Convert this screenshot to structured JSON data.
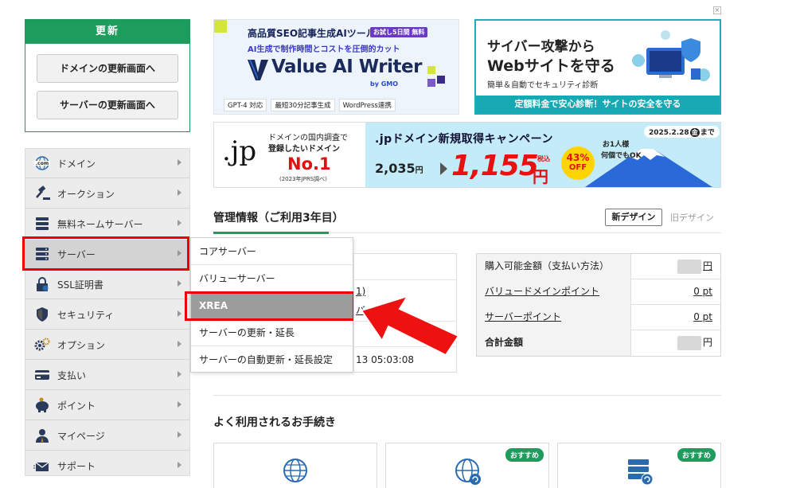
{
  "renew": {
    "title": "更新",
    "domain_btn": "ドメインの更新画面へ",
    "server_btn": "サーバーの更新画面へ"
  },
  "nav": {
    "items": [
      {
        "label": "ドメイン",
        "icon": "globe-com-icon"
      },
      {
        "label": "オークション",
        "icon": "gavel-icon"
      },
      {
        "label": "無料ネームサーバー",
        "icon": "server-icon"
      },
      {
        "label": "サーバー",
        "icon": "server-stack-icon"
      },
      {
        "label": "SSL証明書",
        "icon": "lock-icon"
      },
      {
        "label": "セキュリティ",
        "icon": "shield-icon"
      },
      {
        "label": "オプション",
        "icon": "gears-icon"
      },
      {
        "label": "支払い",
        "icon": "card-icon"
      },
      {
        "label": "ポイント",
        "icon": "piggy-bank-icon"
      },
      {
        "label": "マイページ",
        "icon": "user-icon"
      },
      {
        "label": "サポート",
        "icon": "mail-icon"
      }
    ]
  },
  "submenu": {
    "items": [
      "コアサーバー",
      "バリューサーバー",
      "XREA",
      "サーバーの更新・延長",
      "サーバーの自動更新・延長設定"
    ]
  },
  "banner_ai": {
    "headline": "高品質SEO記事生成AIツール",
    "trial": "お試し5日間 無料",
    "sub": "AI生成で制作時間とコストを圧倒的カット",
    "brand": "Value AI Writer",
    "by": "by GMO",
    "tags": [
      "GPT-4 対応",
      "最短30分記事生成",
      "WordPress連携"
    ]
  },
  "banner_cyber": {
    "line1": "サイバー攻撃から",
    "line2": "Webサイトを守る",
    "sub": "簡単＆自動でセキュリティ診断",
    "footer": "定額料金で安心診断！サイトの安全を守る"
  },
  "banner_jp": {
    "logo": ".jp",
    "survey": "ドメインの国内調査で",
    "want": "登録したいドメイン",
    "no1": "No.1",
    "note": "(2023年JPRS調べ)",
    "campaign": ".jpドメイン新規取得キャンペーン",
    "date": "2025.2.28",
    "date_day": "金",
    "date_suffix": "まで",
    "old_price": "2,035",
    "yen1": "円",
    "new_price": "1,155",
    "tax": "税込",
    "yen2": "円",
    "per": "お1人様",
    "ok": "何個でもOK",
    "pct": "43%",
    "off": "OFF"
  },
  "mgmt": {
    "title": "管理情報（ご利用3年目）",
    "new_design": "新デザイン",
    "old_design": "旧デザイン"
  },
  "info": {
    "partial_link": "1)",
    "partial_text": "バー",
    "timestamp": "13 05:03:08"
  },
  "points": {
    "rows": [
      {
        "label": "購入可能金額（支払い方法）",
        "value": "円"
      },
      {
        "label": "バリュードメインポイント",
        "value": "0 pt"
      },
      {
        "label": "サーバーポイント",
        "value": "0 pt"
      },
      {
        "label": "合計金額",
        "value": "円"
      }
    ]
  },
  "freq": {
    "title": "よく利用されるお手続き",
    "badge": "おすすめ"
  },
  "close": "×",
  "colors": {
    "green": "#1d9d5c",
    "red_highlight": "#ee0000",
    "teal": "#1bb0b6"
  }
}
